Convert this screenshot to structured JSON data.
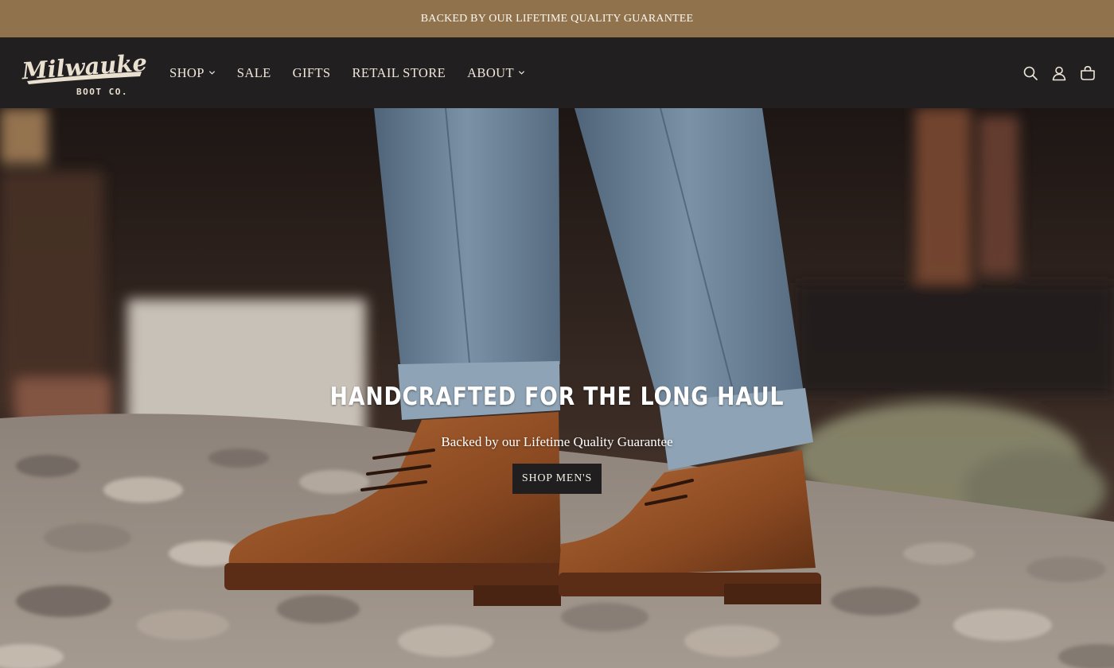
{
  "announcement": {
    "text": "BACKED BY OUR LIFETIME QUALITY GUARANTEE"
  },
  "brand": {
    "logo_text": "Milwaukee",
    "logo_subtext": "BOOT CO."
  },
  "nav": {
    "items": [
      {
        "label": "SHOP",
        "has_dropdown": true
      },
      {
        "label": "SALE",
        "has_dropdown": false
      },
      {
        "label": "GIFTS",
        "has_dropdown": false
      },
      {
        "label": "RETAIL STORE",
        "has_dropdown": false
      },
      {
        "label": "ABOUT",
        "has_dropdown": true
      }
    ]
  },
  "header_icons": [
    "search-icon",
    "account-icon",
    "cart-icon"
  ],
  "hero": {
    "title": "HANDCRAFTED FOR THE LONG HAUL",
    "subtitle": "Backed by our Lifetime Quality Guarantee",
    "cta_label": "SHOP MEN'S"
  },
  "colors": {
    "announcement_bg": "#90734d",
    "header_bg": "#221f21",
    "cta_bg": "#211e20",
    "text_light": "#efe7da"
  }
}
